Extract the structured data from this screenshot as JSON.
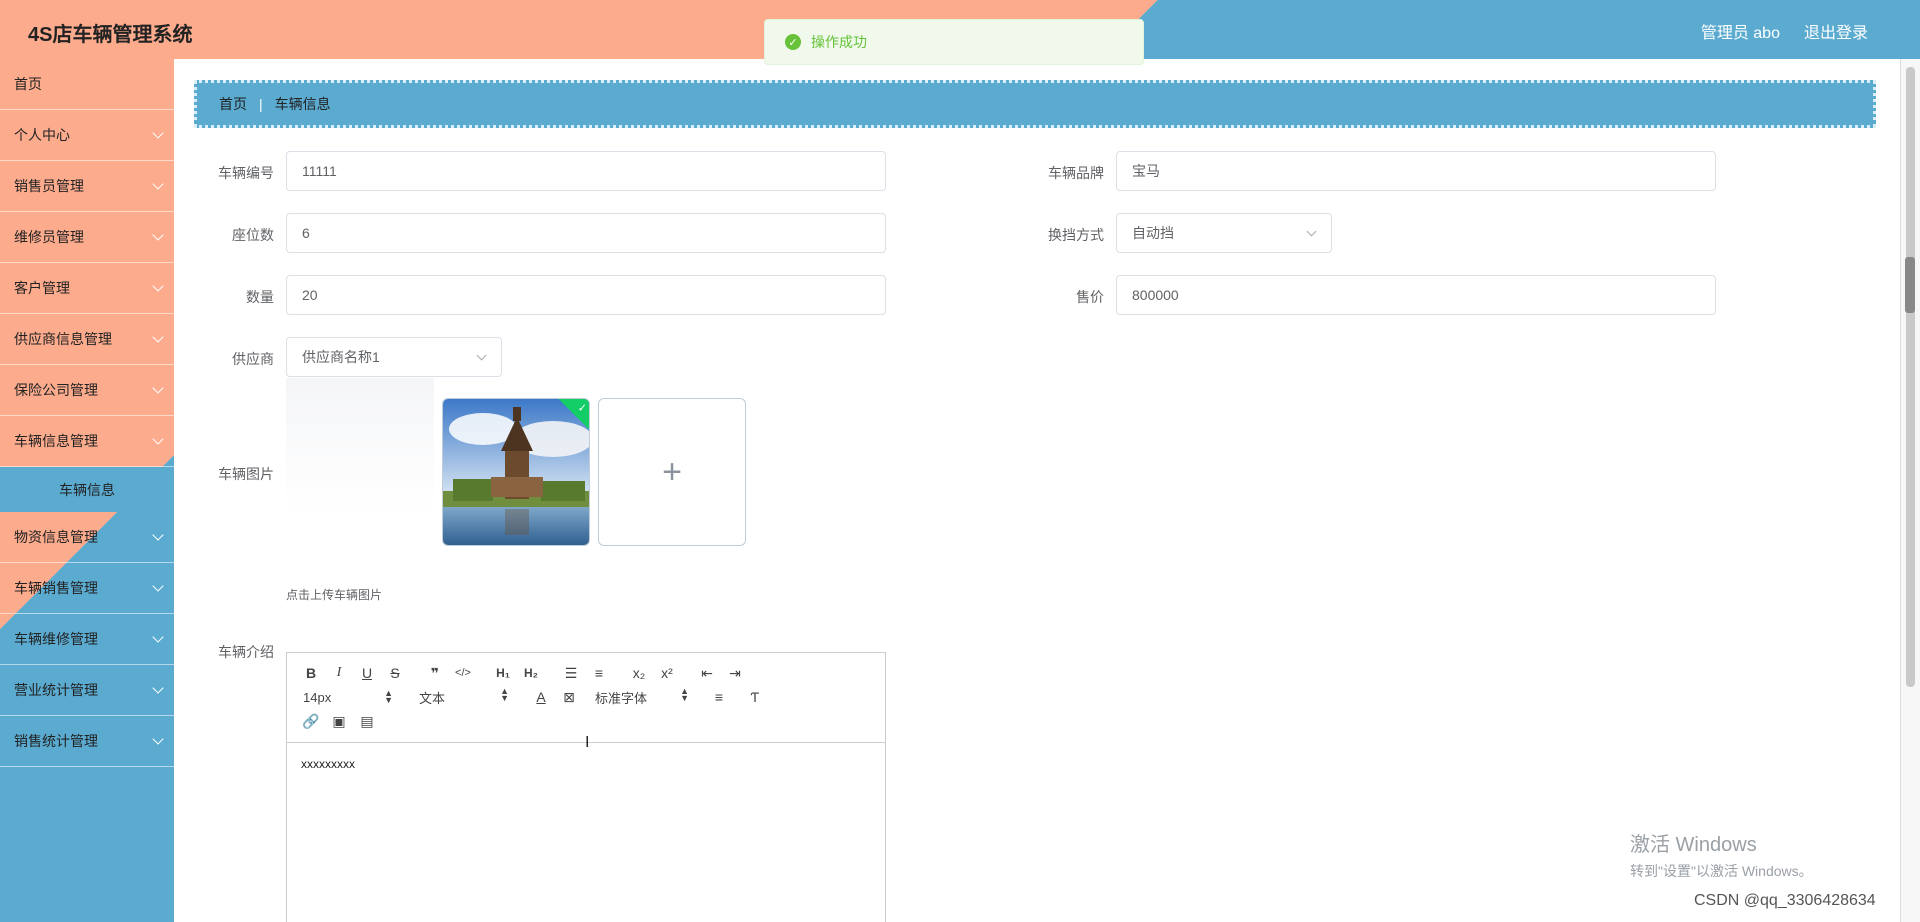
{
  "header": {
    "brand": "4S店车辆管理系统",
    "user_label": "管理员 abo",
    "logout_label": "退出登录"
  },
  "toast": {
    "message": "操作成功",
    "icon": "check-circle-icon",
    "color": "#67c23a"
  },
  "colors": {
    "salmon": "#fcab8d",
    "blue": "#5babd1"
  },
  "sidebar": {
    "items": [
      {
        "label": "首页",
        "has_children": false
      },
      {
        "label": "个人中心",
        "has_children": true
      },
      {
        "label": "销售员管理",
        "has_children": true
      },
      {
        "label": "维修员管理",
        "has_children": true
      },
      {
        "label": "客户管理",
        "has_children": true
      },
      {
        "label": "供应商信息管理",
        "has_children": true
      },
      {
        "label": "保险公司管理",
        "has_children": true
      },
      {
        "label": "车辆信息管理",
        "has_children": true
      },
      {
        "label": "车辆信息",
        "submenu": true
      },
      {
        "label": "物资信息管理",
        "has_children": true
      },
      {
        "label": "车辆销售管理",
        "has_children": true
      },
      {
        "label": "车辆维修管理",
        "has_children": true
      },
      {
        "label": "营业统计管理",
        "has_children": true
      },
      {
        "label": "销售统计管理",
        "has_children": true
      }
    ]
  },
  "breadcrumb": {
    "home": "首页",
    "current": "车辆信息"
  },
  "form": {
    "vehicle_no_label": "车辆编号",
    "vehicle_no": "11111",
    "brand_label": "车辆品牌",
    "brand": "宝马",
    "seats_label": "座位数",
    "seats": "6",
    "gear_label": "换挡方式",
    "gear": "自动挡",
    "quantity_label": "数量",
    "quantity": "20",
    "price_label": "售价",
    "price": "800000",
    "supplier_label": "供应商",
    "supplier": "供应商名称1",
    "image_label": "车辆图片",
    "image_tip": "点击上传车辆图片",
    "intro_label": "车辆介绍"
  },
  "editor": {
    "font_size": "14px",
    "block_type": "文本",
    "font_family": "标准字体",
    "content": "xxxxxxxxx"
  },
  "watermark": {
    "line1": "激活 Windows",
    "line2": "转到\"设置\"以激活 Windows。",
    "csdn": "CSDN @qq_3306428634"
  }
}
